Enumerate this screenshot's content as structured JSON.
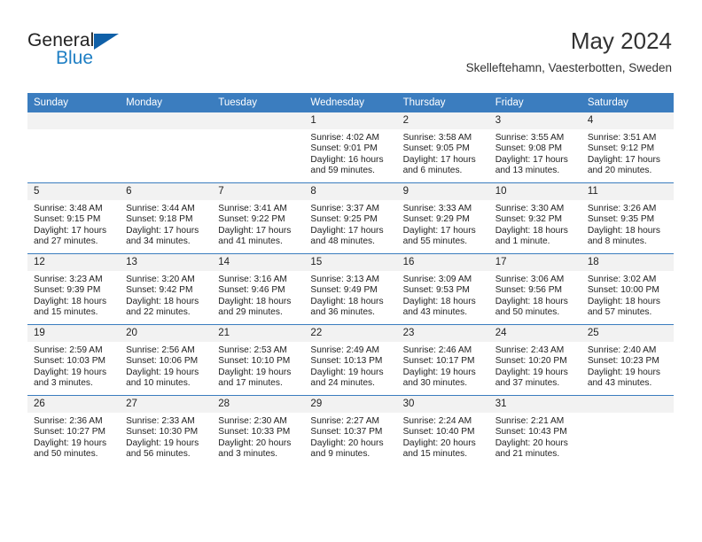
{
  "brand": {
    "line1": "General",
    "line2": "Blue",
    "triangle_icon": "brand-triangle-icon",
    "blue": "#1f7fc4",
    "dark_blue": "#1060a8"
  },
  "header": {
    "title": "May 2024",
    "subtitle": "Skelleftehamn, Vaesterbotten, Sweden"
  },
  "theme": {
    "header_bg": "#3b7dbf",
    "daynum_bg": "#f2f2f2",
    "text": "#222222"
  },
  "weekdays": [
    "Sunday",
    "Monday",
    "Tuesday",
    "Wednesday",
    "Thursday",
    "Friday",
    "Saturday"
  ],
  "labels": {
    "sunrise": "Sunrise:",
    "sunset": "Sunset:",
    "daylight": "Daylight:"
  },
  "weeks": [
    [
      {
        "day": "",
        "empty": true
      },
      {
        "day": "",
        "empty": true
      },
      {
        "day": "",
        "empty": true
      },
      {
        "day": "1",
        "sunrise": "Sunrise: 4:02 AM",
        "sunset": "Sunset: 9:01 PM",
        "daylight": "Daylight: 16 hours and 59 minutes."
      },
      {
        "day": "2",
        "sunrise": "Sunrise: 3:58 AM",
        "sunset": "Sunset: 9:05 PM",
        "daylight": "Daylight: 17 hours and 6 minutes."
      },
      {
        "day": "3",
        "sunrise": "Sunrise: 3:55 AM",
        "sunset": "Sunset: 9:08 PM",
        "daylight": "Daylight: 17 hours and 13 minutes."
      },
      {
        "day": "4",
        "sunrise": "Sunrise: 3:51 AM",
        "sunset": "Sunset: 9:12 PM",
        "daylight": "Daylight: 17 hours and 20 minutes."
      }
    ],
    [
      {
        "day": "5",
        "sunrise": "Sunrise: 3:48 AM",
        "sunset": "Sunset: 9:15 PM",
        "daylight": "Daylight: 17 hours and 27 minutes."
      },
      {
        "day": "6",
        "sunrise": "Sunrise: 3:44 AM",
        "sunset": "Sunset: 9:18 PM",
        "daylight": "Daylight: 17 hours and 34 minutes."
      },
      {
        "day": "7",
        "sunrise": "Sunrise: 3:41 AM",
        "sunset": "Sunset: 9:22 PM",
        "daylight": "Daylight: 17 hours and 41 minutes."
      },
      {
        "day": "8",
        "sunrise": "Sunrise: 3:37 AM",
        "sunset": "Sunset: 9:25 PM",
        "daylight": "Daylight: 17 hours and 48 minutes."
      },
      {
        "day": "9",
        "sunrise": "Sunrise: 3:33 AM",
        "sunset": "Sunset: 9:29 PM",
        "daylight": "Daylight: 17 hours and 55 minutes."
      },
      {
        "day": "10",
        "sunrise": "Sunrise: 3:30 AM",
        "sunset": "Sunset: 9:32 PM",
        "daylight": "Daylight: 18 hours and 1 minute."
      },
      {
        "day": "11",
        "sunrise": "Sunrise: 3:26 AM",
        "sunset": "Sunset: 9:35 PM",
        "daylight": "Daylight: 18 hours and 8 minutes."
      }
    ],
    [
      {
        "day": "12",
        "sunrise": "Sunrise: 3:23 AM",
        "sunset": "Sunset: 9:39 PM",
        "daylight": "Daylight: 18 hours and 15 minutes."
      },
      {
        "day": "13",
        "sunrise": "Sunrise: 3:20 AM",
        "sunset": "Sunset: 9:42 PM",
        "daylight": "Daylight: 18 hours and 22 minutes."
      },
      {
        "day": "14",
        "sunrise": "Sunrise: 3:16 AM",
        "sunset": "Sunset: 9:46 PM",
        "daylight": "Daylight: 18 hours and 29 minutes."
      },
      {
        "day": "15",
        "sunrise": "Sunrise: 3:13 AM",
        "sunset": "Sunset: 9:49 PM",
        "daylight": "Daylight: 18 hours and 36 minutes."
      },
      {
        "day": "16",
        "sunrise": "Sunrise: 3:09 AM",
        "sunset": "Sunset: 9:53 PM",
        "daylight": "Daylight: 18 hours and 43 minutes."
      },
      {
        "day": "17",
        "sunrise": "Sunrise: 3:06 AM",
        "sunset": "Sunset: 9:56 PM",
        "daylight": "Daylight: 18 hours and 50 minutes."
      },
      {
        "day": "18",
        "sunrise": "Sunrise: 3:02 AM",
        "sunset": "Sunset: 10:00 PM",
        "daylight": "Daylight: 18 hours and 57 minutes."
      }
    ],
    [
      {
        "day": "19",
        "sunrise": "Sunrise: 2:59 AM",
        "sunset": "Sunset: 10:03 PM",
        "daylight": "Daylight: 19 hours and 3 minutes."
      },
      {
        "day": "20",
        "sunrise": "Sunrise: 2:56 AM",
        "sunset": "Sunset: 10:06 PM",
        "daylight": "Daylight: 19 hours and 10 minutes."
      },
      {
        "day": "21",
        "sunrise": "Sunrise: 2:53 AM",
        "sunset": "Sunset: 10:10 PM",
        "daylight": "Daylight: 19 hours and 17 minutes."
      },
      {
        "day": "22",
        "sunrise": "Sunrise: 2:49 AM",
        "sunset": "Sunset: 10:13 PM",
        "daylight": "Daylight: 19 hours and 24 minutes."
      },
      {
        "day": "23",
        "sunrise": "Sunrise: 2:46 AM",
        "sunset": "Sunset: 10:17 PM",
        "daylight": "Daylight: 19 hours and 30 minutes."
      },
      {
        "day": "24",
        "sunrise": "Sunrise: 2:43 AM",
        "sunset": "Sunset: 10:20 PM",
        "daylight": "Daylight: 19 hours and 37 minutes."
      },
      {
        "day": "25",
        "sunrise": "Sunrise: 2:40 AM",
        "sunset": "Sunset: 10:23 PM",
        "daylight": "Daylight: 19 hours and 43 minutes."
      }
    ],
    [
      {
        "day": "26",
        "sunrise": "Sunrise: 2:36 AM",
        "sunset": "Sunset: 10:27 PM",
        "daylight": "Daylight: 19 hours and 50 minutes."
      },
      {
        "day": "27",
        "sunrise": "Sunrise: 2:33 AM",
        "sunset": "Sunset: 10:30 PM",
        "daylight": "Daylight: 19 hours and 56 minutes."
      },
      {
        "day": "28",
        "sunrise": "Sunrise: 2:30 AM",
        "sunset": "Sunset: 10:33 PM",
        "daylight": "Daylight: 20 hours and 3 minutes."
      },
      {
        "day": "29",
        "sunrise": "Sunrise: 2:27 AM",
        "sunset": "Sunset: 10:37 PM",
        "daylight": "Daylight: 20 hours and 9 minutes."
      },
      {
        "day": "30",
        "sunrise": "Sunrise: 2:24 AM",
        "sunset": "Sunset: 10:40 PM",
        "daylight": "Daylight: 20 hours and 15 minutes."
      },
      {
        "day": "31",
        "sunrise": "Sunrise: 2:21 AM",
        "sunset": "Sunset: 10:43 PM",
        "daylight": "Daylight: 20 hours and 21 minutes."
      },
      {
        "day": "",
        "empty": true
      }
    ]
  ]
}
